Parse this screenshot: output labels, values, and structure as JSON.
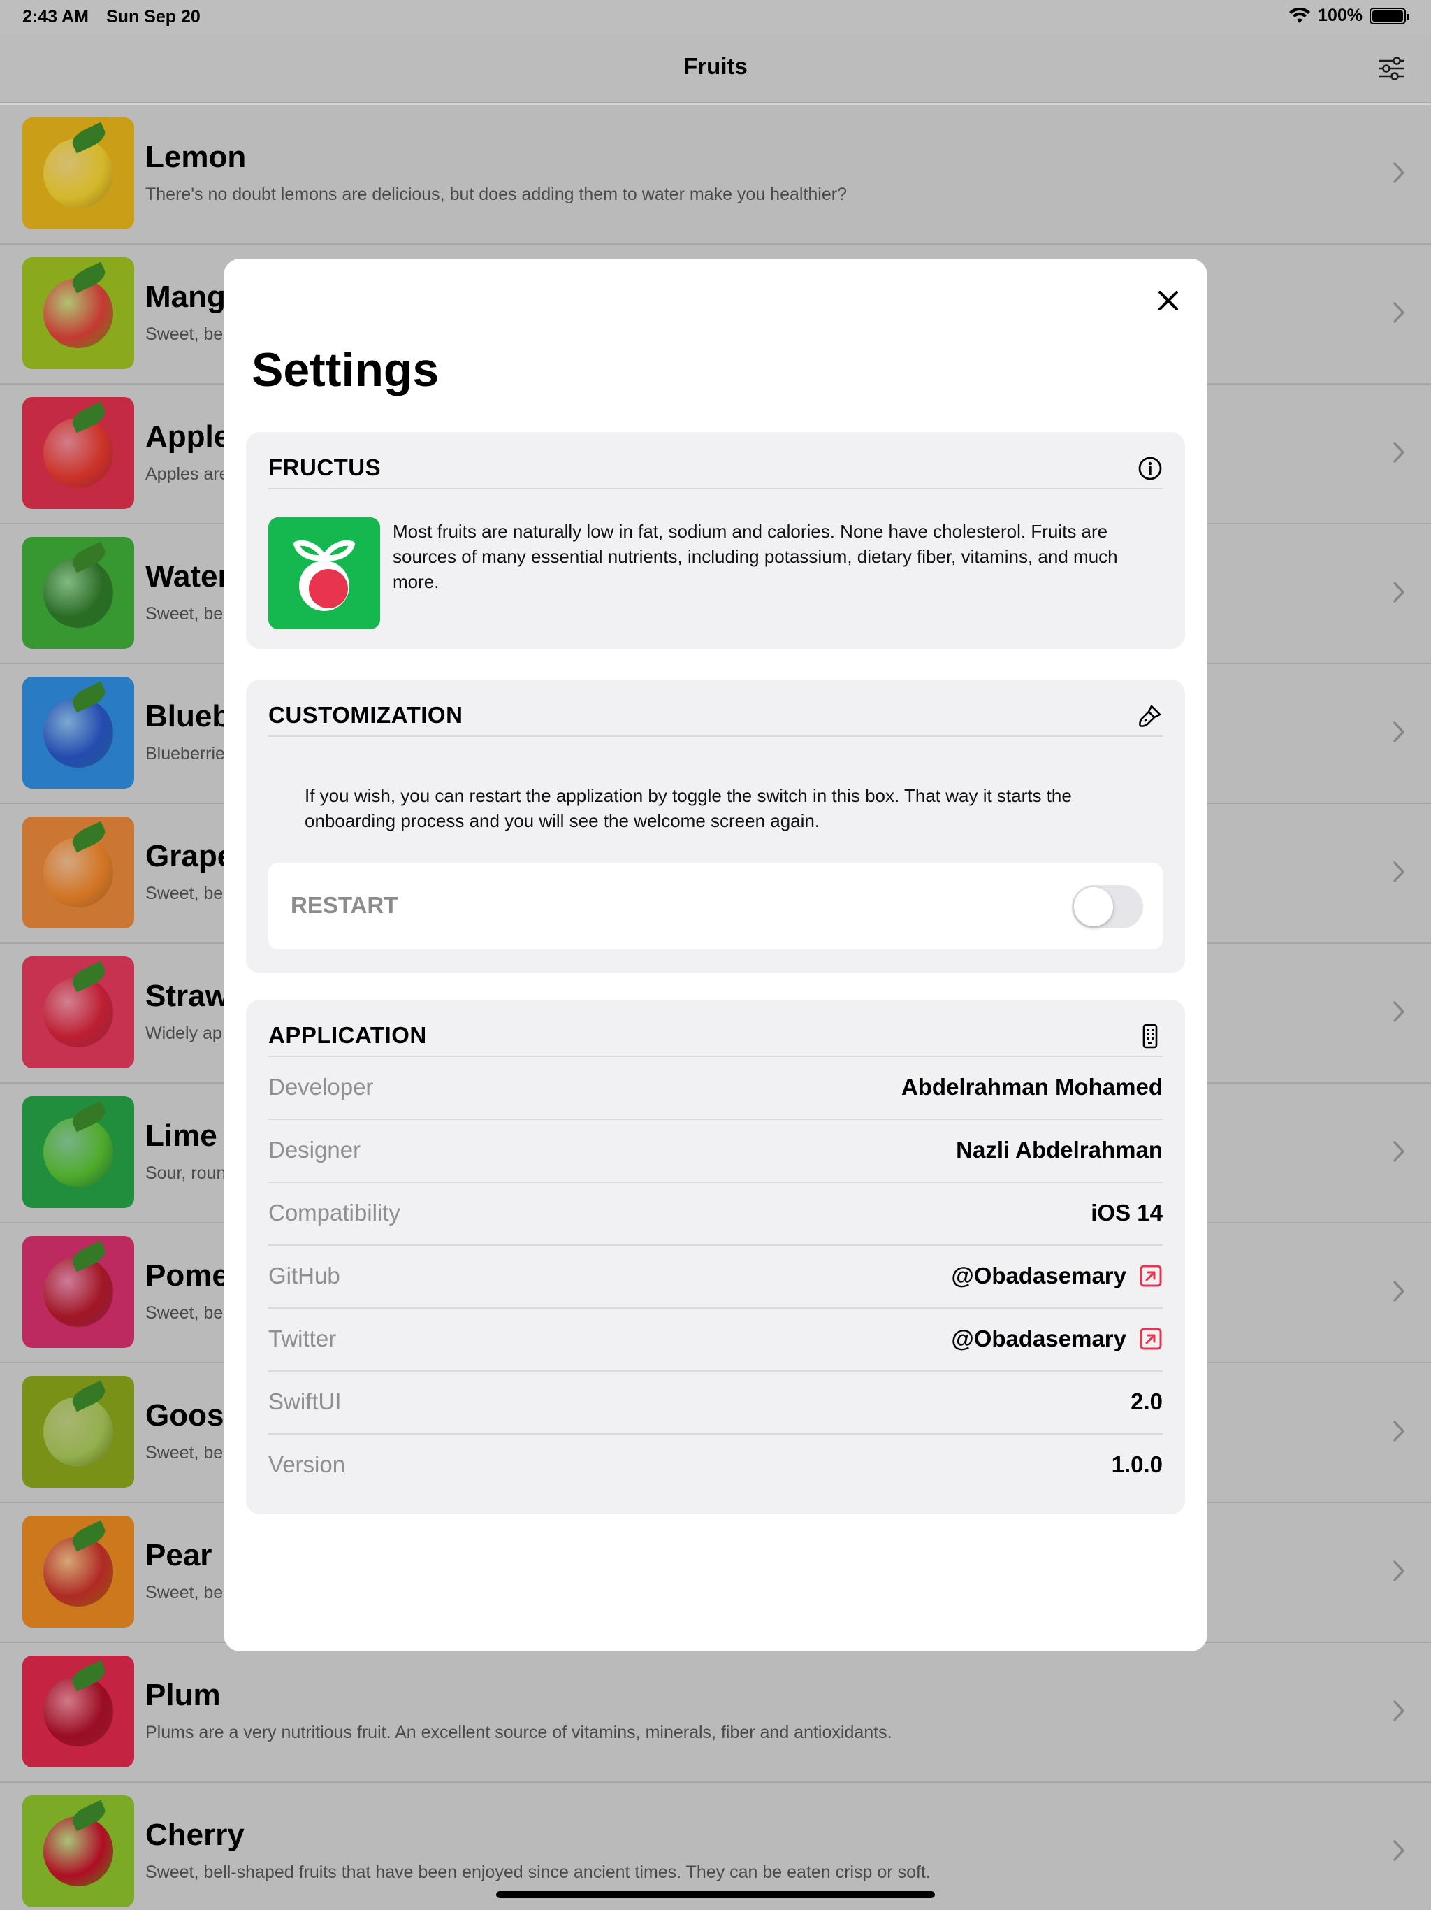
{
  "status": {
    "time": "2:43 AM",
    "date": "Sun Sep 20",
    "battery": "100%"
  },
  "nav": {
    "title": "Fruits"
  },
  "fruits": [
    {
      "title": "Lemon",
      "desc": "There's no doubt lemons are delicious, but does adding them to water make you healthier?",
      "bg": "#e8b41b",
      "fruit": "#f2d230"
    },
    {
      "title": "Mango",
      "desc": "Sweet, be",
      "bg": "#9cc220",
      "fruit": "#e0423a"
    },
    {
      "title": "Apple",
      "desc": "Apples are",
      "bg": "#e0304a",
      "fruit": "#e83a2e"
    },
    {
      "title": "Watermelon",
      "desc": "Sweet, be",
      "bg": "#3fae3a",
      "fruit": "#2f7a2a"
    },
    {
      "title": "Blueberry",
      "desc": "Blueberrie",
      "bg": "#2f8de0",
      "fruit": "#2a56c8"
    },
    {
      "title": "Grapefruit",
      "desc": "Sweet, be",
      "bg": "#e7873a",
      "fruit": "#f0862a"
    },
    {
      "title": "Strawberry",
      "desc": "Widely ap",
      "bg": "#e23a5a",
      "fruit": "#d8233a"
    },
    {
      "title": "Lime",
      "desc": "Sour, roun",
      "bg": "#25a246",
      "fruit": "#5cc232"
    },
    {
      "title": "Pomegranate",
      "desc": "Sweet, be",
      "bg": "#d8306e",
      "fruit": "#b81a2a"
    },
    {
      "title": "Gooseberry",
      "desc": "Sweet, be",
      "bg": "#8aa61a",
      "fruit": "#a8c85a"
    },
    {
      "title": "Pear",
      "desc": "Sweet, be",
      "bg": "#e88a20",
      "fruit": "#c8302a"
    },
    {
      "title": "Plum",
      "desc": "Plums are a very nutritious fruit. An excellent source of vitamins, minerals, fiber and antioxidants.",
      "bg": "#e02a4a",
      "fruit": "#b01028"
    },
    {
      "title": "Cherry",
      "desc": "Sweet, bell-shaped fruits that have been enjoyed since ancient times. They can be eaten crisp or soft.",
      "bg": "#8cc22a",
      "fruit": "#c8102a"
    }
  ],
  "settings": {
    "title": "Settings",
    "fructus": {
      "label": "FRUCTUS",
      "icon": "info-circle-icon",
      "text": "Most fruits are naturally low in fat, sodium and calories. None have cholesterol. Fruits are sources of many essential nutrients, including potassium, dietary fiber, vitamins, and much more."
    },
    "customization": {
      "label": "CUSTOMIZATION",
      "icon": "paintbrush-icon",
      "text": "If you wish, you can restart the applization by toggle the switch in this box. That way it starts the onboarding process and you will see the welcome screen again.",
      "restart_label": "RESTART",
      "restart_on": false
    },
    "application": {
      "label": "APPLICATION",
      "icon": "device-icon",
      "rows": [
        {
          "key": "Developer",
          "value": "Abdelrahman Mohamed",
          "link": false
        },
        {
          "key": "Designer",
          "value": "Nazli Abdelrahman",
          "link": false
        },
        {
          "key": "Compatibility",
          "value": "iOS 14",
          "link": false
        },
        {
          "key": "GitHub",
          "value": "@Obadasemary",
          "link": true
        },
        {
          "key": "Twitter",
          "value": "@Obadasemary",
          "link": true
        },
        {
          "key": "SwiftUI",
          "value": "2.0",
          "link": false
        },
        {
          "key": "Version",
          "value": "1.0.0",
          "link": false
        }
      ]
    },
    "accent": "#e8344e"
  }
}
